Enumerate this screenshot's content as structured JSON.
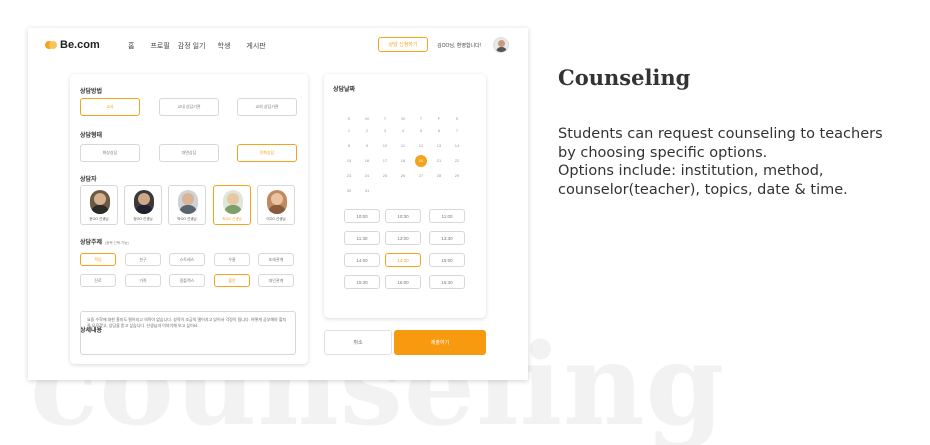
{
  "watermark": "counseling",
  "brand": {
    "logo": "Be.com",
    "accent": "#f5a31a"
  },
  "nav": [
    "홈",
    "프로필",
    "감정 일기",
    "학생",
    "게시판"
  ],
  "header": {
    "apply_button": "상담 신청하기",
    "greeting": "김OO님, 환영합니다!"
  },
  "method": {
    "title": "상담방법",
    "options": [
      "교사",
      "교내 상담기관",
      "교외 상담기관"
    ],
    "selected": 0
  },
  "form": {
    "title": "상담형태",
    "options": [
      "화상상담",
      "대면상담",
      "전화상담"
    ],
    "selected": 2
  },
  "counselor": {
    "title": "상담자",
    "people": [
      {
        "name": "윤OO 선생님",
        "photo": "counselor-photo-1"
      },
      {
        "name": "정OO 선생님",
        "photo": "counselor-photo-2"
      },
      {
        "name": "박OO 선생님",
        "photo": "counselor-photo-3"
      },
      {
        "name": "최OO 선생님",
        "photo": "counselor-photo-4"
      },
      {
        "name": "이OO 선생님",
        "photo": "counselor-photo-5"
      }
    ],
    "selected": 3
  },
  "topics": {
    "title": "상담주제",
    "note": "(중복 선택 가능)",
    "options": [
      "학업",
      "친구",
      "스트레스",
      "우울",
      "또래관계",
      "진로",
      "가족",
      "콤플렉스",
      "불안",
      "대인관계"
    ],
    "selected": [
      0,
      8
    ]
  },
  "details": {
    "title": "상세내용",
    "text": "요즘 수학에 대한 흥미도 떨어지고 의욕이 없습니다. 성적이 조금씩 떨어지고 있어서 걱정이 됩니다. 어떻게 공부해야 할지 잘 모르겠고, 상담을 받고 싶습니다. 선생님과 이야기해 보고 싶어요."
  },
  "calendar": {
    "title": "상담날짜",
    "weekdays": [
      "S",
      "M",
      "T",
      "W",
      "T",
      "F",
      "S"
    ],
    "days": [
      "1",
      "2",
      "3",
      "4",
      "5",
      "6",
      "7",
      "8",
      "9",
      "10",
      "11",
      "12",
      "13",
      "14",
      "15",
      "16",
      "17",
      "18",
      "19",
      "20",
      "21",
      "22",
      "23",
      "24",
      "25",
      "26",
      "27",
      "28",
      "29",
      "30",
      "31"
    ],
    "selected_day": "20"
  },
  "times": {
    "slots": [
      "10:00",
      "10:30",
      "11:00",
      "11:30",
      "13:00",
      "13:30",
      "14:00",
      "14:30",
      "15:00",
      "15:30",
      "16:00",
      "16:30"
    ],
    "selected": "14:30"
  },
  "actions": {
    "cancel": "취소",
    "submit": "제출하기"
  },
  "description": {
    "title": "Counseling",
    "lines": [
      "Students can request counseling to teachers",
      "by choosing specific options.",
      "Options include: institution, method,",
      "counselor(teacher), topics, date & time."
    ]
  }
}
